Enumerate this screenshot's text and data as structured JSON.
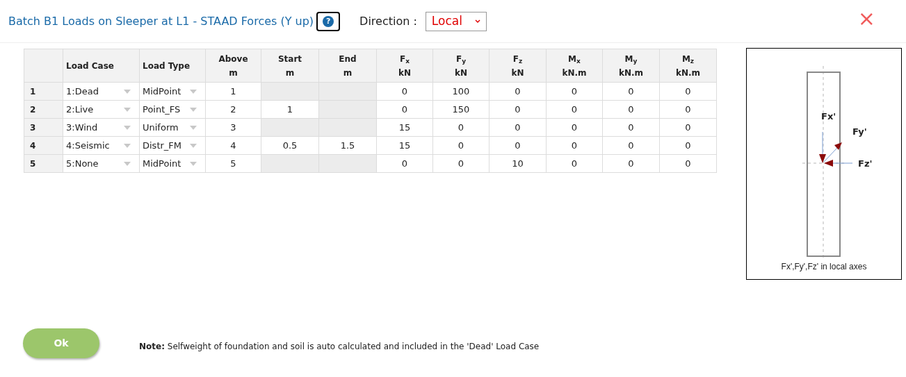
{
  "title": "Batch B1 Loads on Sleeper at L1 - STAAD Forces (Y up)",
  "help_icon": "?",
  "direction": {
    "label": "Direction :",
    "value": "Local"
  },
  "close": "×",
  "table": {
    "columns": [
      {},
      {
        "line1": "Load Case"
      },
      {
        "line1": "Load Type"
      },
      {
        "line1": "Above",
        "line2": "m"
      },
      {
        "line1": "Start",
        "line2": "m"
      },
      {
        "line1": "End",
        "line2": "m"
      },
      {
        "line1": "F$_{x}$",
        "line2": "kN"
      },
      {
        "line1": "F$_{y}$",
        "line2": "kN"
      },
      {
        "line1": "F$_{z}$",
        "line2": "kN"
      },
      {
        "line1": "M$_{x}$",
        "line2": "kN.m"
      },
      {
        "line1": "M$_{y}$",
        "line2": "kN.m"
      },
      {
        "line1": "M$_{z}$",
        "line2": "kN.m"
      }
    ],
    "rows": [
      {
        "number": "1",
        "load_case": "1:Dead",
        "load_type": "MidPoint",
        "above": "1",
        "start": {
          "disabled": true
        },
        "end": {
          "disabled": true
        },
        "values": [
          "0",
          "100",
          "0",
          "0",
          "0",
          "0"
        ]
      },
      {
        "number": "2",
        "load_case": "2:Live",
        "load_type": "Point_FS",
        "above": "2",
        "start": {
          "text": "1",
          "disabled": false
        },
        "end": {
          "disabled": true
        },
        "values": [
          "0",
          "150",
          "0",
          "0",
          "0",
          "0"
        ]
      },
      {
        "number": "3",
        "load_case": "3:Wind",
        "load_type": "Uniform",
        "above": "3",
        "start": {
          "disabled": true
        },
        "end": {
          "disabled": true
        },
        "values": [
          "15",
          "0",
          "0",
          "0",
          "0",
          "0"
        ]
      },
      {
        "number": "4",
        "load_case": "4:Seismic",
        "load_type": "Distr_FM",
        "above": "4",
        "start": {
          "text": "0.5",
          "disabled": false
        },
        "end": {
          "text": "1.5",
          "disabled": false
        },
        "values": [
          "15",
          "0",
          "0",
          "0",
          "0",
          "0"
        ]
      },
      {
        "number": "5",
        "load_case": "5:None",
        "load_type": "MidPoint",
        "above": "5",
        "start": {
          "disabled": true
        },
        "end": {
          "disabled": true
        },
        "values": [
          "0",
          "0",
          "10",
          "0",
          "0",
          "0"
        ]
      }
    ]
  },
  "diagram": {
    "labels": [
      "Fx'",
      "Fy'",
      "Fz'"
    ],
    "caption": "Fx',Fy',Fz' in local axes"
  },
  "ok_button": "Ok",
  "note": "**Note:** Selfweight of foundation and soil is auto calculated and included in the 'Dead' Load Case"
}
